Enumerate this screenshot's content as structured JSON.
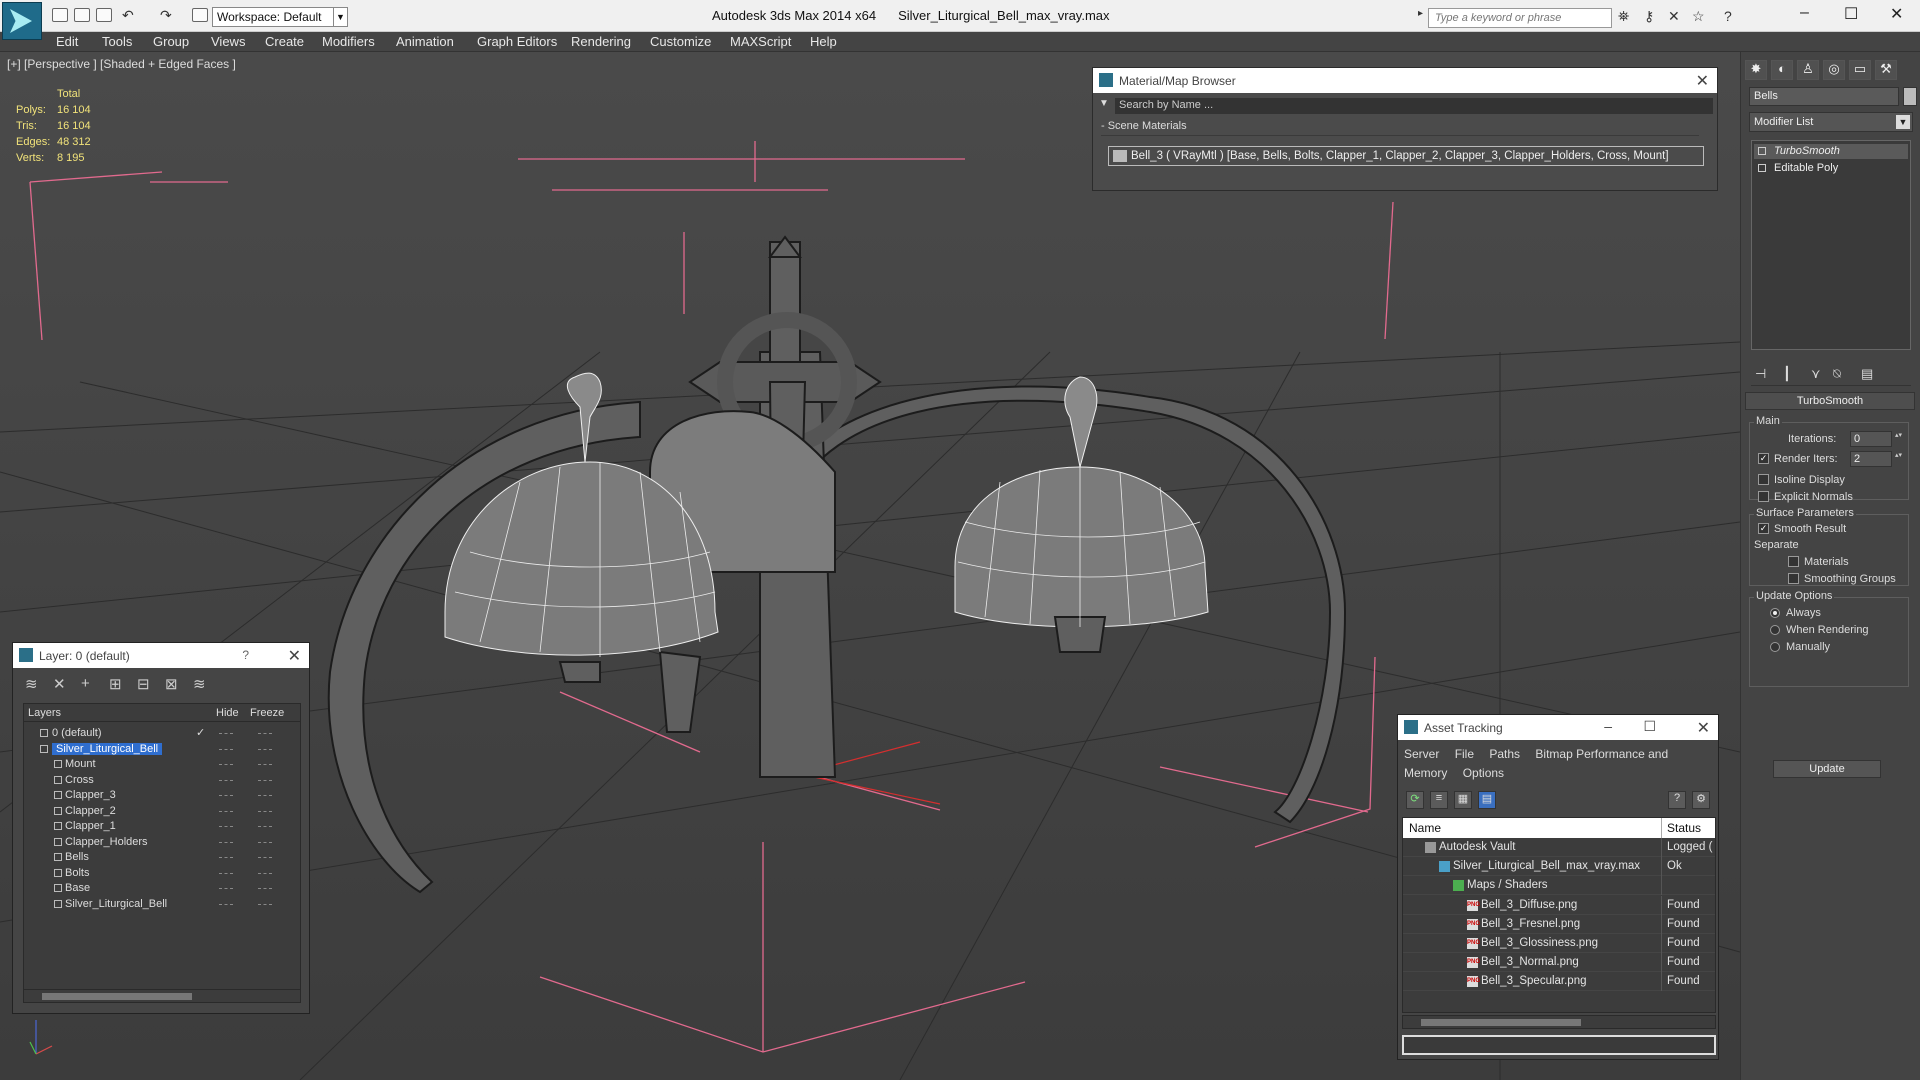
{
  "titlebar": {
    "workspace": "Workspace: Default",
    "app_name": "Autodesk 3ds Max  2014 x64",
    "file_name": "Silver_Liturgical_Bell_max_vray.max",
    "search_placeholder": "Type a keyword or phrase"
  },
  "menu": [
    "Edit",
    "Tools",
    "Group",
    "Views",
    "Create",
    "Modifiers",
    "Animation",
    "Graph Editors",
    "Rendering",
    "Customize",
    "MAXScript",
    "Help"
  ],
  "viewport": {
    "label": "[+] [Perspective ] [Shaded + Edged Faces ]",
    "stats_header": "Total",
    "stats": [
      {
        "key": "Polys:",
        "value": "16 104"
      },
      {
        "key": "Tris:",
        "value": "16 104"
      },
      {
        "key": "Edges:",
        "value": "48 312"
      },
      {
        "key": "Verts:",
        "value": "8 195"
      }
    ]
  },
  "material_browser": {
    "title": "Material/Map Browser",
    "search_placeholder": "Search by Name ...",
    "section": "- Scene Materials",
    "item": "Bell_3  ( VRayMtl )  [Base, Bells, Bolts, Clapper_1, Clapper_2, Clapper_3, Clapper_Holders, Cross, Mount]"
  },
  "command_panel": {
    "object_name": "Bells",
    "object_color": "#bbbbbb",
    "modifier_list": "Modifier List",
    "stack": [
      "TurboSmooth",
      "Editable Poly"
    ],
    "rollout": {
      "title": "TurboSmooth",
      "main": "Main",
      "iterations_label": "Iterations:",
      "iterations_value": "0",
      "render_iters_label": "Render Iters:",
      "render_iters_value": "2",
      "render_iters_checked": true,
      "isoline_label": "Isoline Display",
      "explicit_label": "Explicit Normals",
      "surface_params": "Surface Parameters",
      "smooth_result": "Smooth Result",
      "separate": "Separate",
      "materials": "Materials",
      "smoothing_groups": "Smoothing Groups",
      "update_options": "Update Options",
      "always": "Always",
      "when_rendering": "When Rendering",
      "manually": "Manually",
      "update_button": "Update"
    }
  },
  "layer_explorer": {
    "title": "Layer: 0 (default)",
    "help": "?",
    "columns": {
      "layers": "Layers",
      "hide": "Hide",
      "freeze": "Freeze"
    },
    "rows": [
      {
        "name": "0 (default)",
        "level": 0,
        "kind": "layer",
        "check": "✓"
      },
      {
        "name": "Silver_Liturgical_Bell",
        "level": 0,
        "kind": "layer",
        "selected": true
      },
      {
        "name": "Mount",
        "level": 1,
        "kind": "object"
      },
      {
        "name": "Cross",
        "level": 1,
        "kind": "object"
      },
      {
        "name": "Clapper_3",
        "level": 1,
        "kind": "object"
      },
      {
        "name": "Clapper_2",
        "level": 1,
        "kind": "object"
      },
      {
        "name": "Clapper_1",
        "level": 1,
        "kind": "object"
      },
      {
        "name": "Clapper_Holders",
        "level": 1,
        "kind": "object"
      },
      {
        "name": "Bells",
        "level": 1,
        "kind": "object"
      },
      {
        "name": "Bolts",
        "level": 1,
        "kind": "object"
      },
      {
        "name": "Base",
        "level": 1,
        "kind": "object"
      },
      {
        "name": "Silver_Liturgical_Bell",
        "level": 1,
        "kind": "object"
      }
    ]
  },
  "asset_tracking": {
    "title": "Asset Tracking",
    "menu": [
      "Server",
      "File",
      "Paths",
      "Bitmap Performance and Memory",
      "Options"
    ],
    "columns": {
      "name": "Name",
      "status": "Status"
    },
    "rows": [
      {
        "name": "Autodesk Vault",
        "status": "Logged (",
        "level": 0,
        "icon": "vault"
      },
      {
        "name": "Silver_Liturgical_Bell_max_vray.max",
        "status": "Ok",
        "level": 1,
        "icon": "max"
      },
      {
        "name": "Maps / Shaders",
        "status": "",
        "level": 2,
        "icon": "maps"
      },
      {
        "name": "Bell_3_Diffuse.png",
        "status": "Found",
        "level": 3,
        "icon": "png"
      },
      {
        "name": "Bell_3_Fresnel.png",
        "status": "Found",
        "level": 3,
        "icon": "png"
      },
      {
        "name": "Bell_3_Glossiness.png",
        "status": "Found",
        "level": 3,
        "icon": "png"
      },
      {
        "name": "Bell_3_Normal.png",
        "status": "Found",
        "level": 3,
        "icon": "png"
      },
      {
        "name": "Bell_3_Specular.png",
        "status": "Found",
        "level": 3,
        "icon": "png"
      }
    ]
  }
}
